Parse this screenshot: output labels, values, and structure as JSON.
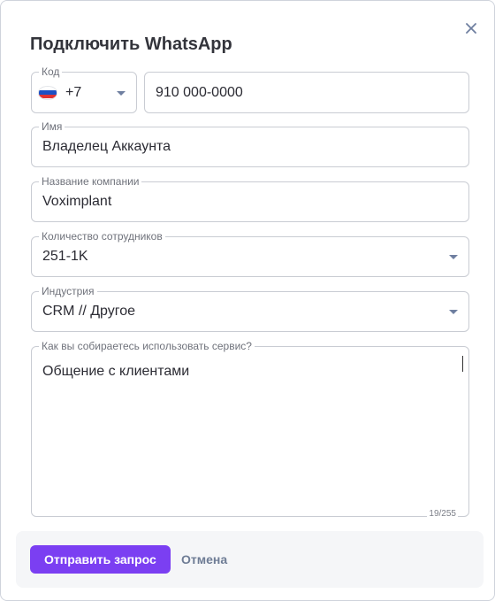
{
  "dialog": {
    "title": "Подключить WhatsApp"
  },
  "phone": {
    "code_label": "Код",
    "country_code": "+7",
    "country_flag": "russia-flag-icon",
    "number": "910 000-0000"
  },
  "name": {
    "label": "Имя",
    "value": "Владелец Аккаунта"
  },
  "company": {
    "label": "Название компании",
    "value": "Voximplant"
  },
  "employees": {
    "label": "Количество сотрудников",
    "value": "251-1K"
  },
  "industry": {
    "label": "Индустрия",
    "value": "CRM // Другое"
  },
  "usage": {
    "label": "Как вы собираетесь использовать сервис?",
    "value": "Общение с клиентами",
    "counter": "19/255"
  },
  "footer": {
    "submit_label": "Отправить запрос",
    "cancel_label": "Отмена"
  },
  "colors": {
    "accent": "#7b3ff2",
    "cancel_text": "#6e7c95",
    "field_border": "#c9ccd3",
    "footer_bg": "#f5f6f8"
  }
}
